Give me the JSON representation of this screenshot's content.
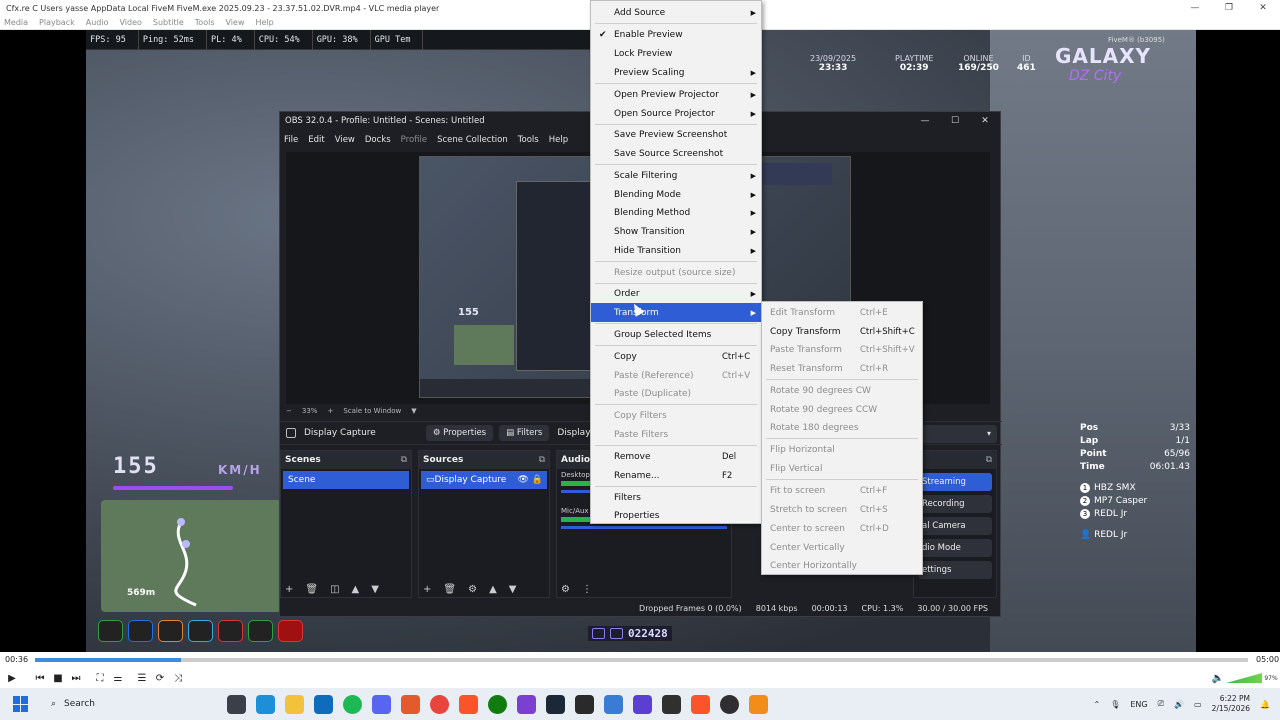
{
  "vlc": {
    "title": "Cfx.re  C  Users yasse AppData Local FiveM FiveM.exe 2025.09.23 - 23.37.51.02.DVR.mp4 - VLC media player",
    "menu": [
      "Media",
      "Playback",
      "Audio",
      "Video",
      "Subtitle",
      "Tools",
      "View",
      "Help"
    ],
    "time_elapsed": "00:36",
    "time_total": "05:00",
    "progress": 0.12,
    "volume_pct": "97%"
  },
  "overlay_stats": {
    "fps": "FPS: 95",
    "ping": "Ping: 52ms",
    "pl": "PL: 4%",
    "cpu": "CPU: 54%",
    "gpu": "GPU: 38%",
    "gpu_temp": "GPU Tem"
  },
  "hud": {
    "date": "23/09/2025",
    "time": "23:33",
    "playtime_label": "PLAYTIME",
    "playtime": "02:39",
    "online_label": "ONLINE",
    "online": "169/250",
    "id_label": "ID",
    "id": "461",
    "logo_text": "GALAXY",
    "logo_sub": "DZ City",
    "player_tag": "FiveM® (b3095)",
    "speed": "155",
    "speed_unit": "KM/H",
    "distance": "569m",
    "timer": "022428",
    "race": {
      "pos_label": "Pos",
      "pos": "3/33",
      "lap_label": "Lap",
      "lap": "1/1",
      "point_label": "Point",
      "point": "65/96",
      "time_label": "Time",
      "time": "06:01.43",
      "players": [
        {
          "n": "1",
          "name": "HBZ SMX"
        },
        {
          "n": "2",
          "name": "MP7 Casper"
        },
        {
          "n": "3",
          "name": "REDL Jr"
        }
      ],
      "me": "REDL Jr"
    }
  },
  "obs": {
    "title": "OBS 32.0.4 - Profile: Untitled - Scenes: Untitled",
    "menu": [
      "File",
      "Edit",
      "View",
      "Docks",
      "Profile",
      "Scene Collection",
      "Tools",
      "Help"
    ],
    "zoom": "33%",
    "scale_label": "Scale to Window",
    "source_name": "Display Capture",
    "properties": "Properties",
    "filters": "Filters",
    "display": "Display",
    "scenes_title": "Scenes",
    "scene_item": "Scene",
    "sources_title": "Sources",
    "source_item": "Display Capture",
    "audio_title": "Audio M",
    "audio_desktop": "Desktop",
    "audio_mic": "Mic/Aux",
    "controls": [
      "Streaming",
      "Recording",
      "al Camera",
      "dio Mode",
      "ettings"
    ],
    "dropped": "Dropped Frames 0 (0.0%)",
    "kbps": "8014 kbps",
    "rec_time": "00:00:13",
    "cpu": "CPU: 1.3%",
    "fps": "30.00 / 30.00 FPS"
  },
  "context_menu": {
    "items": [
      {
        "label": "Add Source",
        "arrow": true
      },
      {
        "label": "Enable Preview",
        "checked": true
      },
      {
        "label": "Lock Preview"
      },
      {
        "label": "Preview Scaling",
        "arrow": true
      },
      {
        "label": "Open Preview Projector",
        "arrow": true
      },
      {
        "label": "Open Source Projector",
        "arrow": true
      },
      {
        "label": "Save Preview Screenshot"
      },
      {
        "label": "Save Source Screenshot"
      },
      {
        "label": "Scale Filtering",
        "arrow": true
      },
      {
        "label": "Blending Mode",
        "arrow": true
      },
      {
        "label": "Blending Method",
        "arrow": true
      },
      {
        "label": "Show Transition",
        "arrow": true
      },
      {
        "label": "Hide Transition",
        "arrow": true
      },
      {
        "label": "Resize output (source size)",
        "disabled": true
      },
      {
        "label": "Order",
        "arrow": true
      },
      {
        "label": "Transform",
        "arrow": true,
        "highlighted": true
      },
      {
        "label": "Group Selected Items"
      },
      {
        "label": "Copy",
        "shortcut": "Ctrl+C"
      },
      {
        "label": "Paste (Reference)",
        "shortcut": "Ctrl+V",
        "disabled": true
      },
      {
        "label": "Paste (Duplicate)",
        "disabled": true
      },
      {
        "label": "Copy Filters",
        "disabled": true
      },
      {
        "label": "Paste Filters",
        "disabled": true
      },
      {
        "label": "Remove",
        "shortcut": "Del"
      },
      {
        "label": "Rename...",
        "shortcut": "F2"
      },
      {
        "label": "Filters"
      },
      {
        "label": "Properties"
      }
    ]
  },
  "transform_menu": {
    "items": [
      {
        "label": "Edit Transform",
        "shortcut": "Ctrl+E",
        "disabled": true
      },
      {
        "label": "Copy Transform",
        "shortcut": "Ctrl+Shift+C"
      },
      {
        "label": "Paste Transform",
        "shortcut": "Ctrl+Shift+V",
        "disabled": true
      },
      {
        "label": "Reset Transform",
        "shortcut": "Ctrl+R",
        "disabled": true
      },
      {
        "label": "Rotate 90 degrees CW",
        "disabled": true
      },
      {
        "label": "Rotate 90 degrees CCW",
        "disabled": true
      },
      {
        "label": "Rotate 180 degrees",
        "disabled": true
      },
      {
        "label": "Flip Horizontal",
        "disabled": true
      },
      {
        "label": "Flip Vertical",
        "disabled": true
      },
      {
        "label": "Fit to screen",
        "shortcut": "Ctrl+F",
        "disabled": true
      },
      {
        "label": "Stretch to screen",
        "shortcut": "Ctrl+S",
        "disabled": true
      },
      {
        "label": "Center to screen",
        "shortcut": "Ctrl+D",
        "disabled": true
      },
      {
        "label": "Center Vertically",
        "disabled": true
      },
      {
        "label": "Center Horizontally",
        "disabled": true
      }
    ]
  },
  "taskbar": {
    "search": "Search",
    "lang": "ENG",
    "time": "6:22 PM",
    "date": "2/15/2026"
  }
}
